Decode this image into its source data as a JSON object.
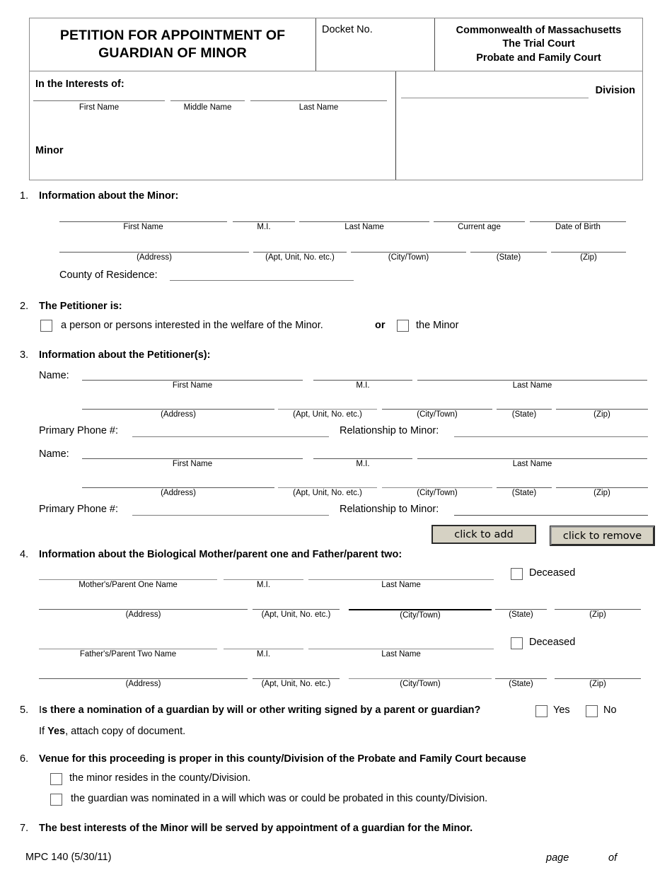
{
  "header": {
    "form_title": "PETITION FOR APPOINTMENT OF GUARDIAN OF MINOR",
    "docket_label": "Docket No.",
    "court_line1": "Commonwealth of Massachusetts",
    "court_line2": "The Trial Court",
    "court_line3": "Probate and Family Court",
    "division_label": "Division",
    "in_the_interests_of": "In the Interests of:",
    "minor_label": "Minor",
    "interest_captions": [
      "First Name",
      "Middle Name",
      "Last Name"
    ]
  },
  "sections": {
    "s1": {
      "number": "1.",
      "heading": "Information about the Minor:",
      "name_captions": [
        "First Name",
        "M.I.",
        "Last Name",
        "Current age",
        "Date of Birth"
      ],
      "address_captions": [
        "(Address)",
        "(Apt, Unit, No. etc.)",
        "(City/Town)",
        "(State)",
        "(Zip)"
      ],
      "county_label": "County of Residence:"
    },
    "s2": {
      "number": "2.",
      "heading": "The Petitioner is:",
      "option_a": "a person or persons interested in the welfare of the Minor.",
      "conjunction": "or",
      "option_b": "the Minor"
    },
    "s3": {
      "number": "3.",
      "heading": "Information about the Petitioner(s):",
      "name_label": "Name:",
      "name_captions": [
        "First Name",
        "M.I.",
        "Last Name"
      ],
      "address_captions": [
        "(Address)",
        "(Apt, Unit, No. etc.)",
        "(City/Town)",
        "(State)",
        "(Zip)"
      ],
      "phone_label": "Primary Phone #:",
      "relationship_label": "Relationship to Minor:",
      "add_button": "click to add",
      "remove_button": "click to remove"
    },
    "s4": {
      "number": "4.",
      "heading": "Information about the Biological Mother/parent one and Father/parent two:",
      "mother_caption": "Mother's/Parent One Name",
      "father_caption": "Father's/Parent Two Name",
      "mi_caption": "M.I.",
      "last_caption": "Last Name",
      "deceased_label": "Deceased",
      "address_captions": [
        "(Address)",
        "(Apt, Unit, No. etc.)",
        "(City/Town)",
        "(State)",
        "(Zip)"
      ]
    },
    "s5": {
      "number": "5.",
      "question_lead": "I",
      "question_rest": "s there a nomination of a guardian by will or other writing signed by a parent or guardian?",
      "yes_label": "Yes",
      "no_label": "No",
      "note_pre": "If ",
      "note_bold": "Yes",
      "note_post": ", attach copy of document."
    },
    "s6": {
      "number": "6.",
      "heading": "Venue for this proceeding is proper in this county/Division of the Probate and Family Court because",
      "option_a": "the minor resides in the county/Division.",
      "option_b": "the guardian was nominated in a will which was or could be probated in this county/Division."
    },
    "s7": {
      "number": "7.",
      "heading": "The best interests of the Minor will be served by appointment of a guardian for the Minor."
    }
  },
  "footer": {
    "form_code": "MPC 140 (5/30/11)",
    "page_label": "page",
    "of_label": "of"
  }
}
